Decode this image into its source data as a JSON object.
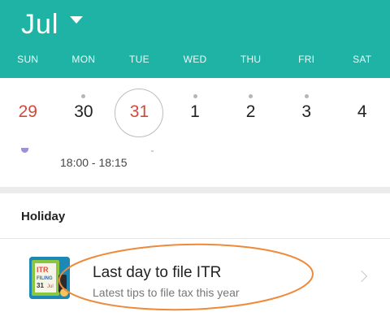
{
  "header": {
    "month": "Jul",
    "bg_color": "#1fb3a5"
  },
  "weekdays": [
    "SUN",
    "MON",
    "TUE",
    "WED",
    "THU",
    "FRI",
    "SAT"
  ],
  "days": [
    {
      "num": "29",
      "dot": false
    },
    {
      "num": "30",
      "dot": true
    },
    {
      "num": "31",
      "dot": false
    },
    {
      "num": "1",
      "dot": true
    },
    {
      "num": "2",
      "dot": true
    },
    {
      "num": "3",
      "dot": true
    },
    {
      "num": "4",
      "dot": false
    }
  ],
  "event": {
    "time": "18:00 - 18:15"
  },
  "holiday": {
    "section_title": "Holiday",
    "item_title": "Last day to file ITR",
    "item_subtitle": "Latest tips to file tax this year",
    "thumbnail_text": [
      "ITR",
      "FILING",
      "31",
      "Jul"
    ]
  },
  "colors": {
    "accent": "#1fb3a5",
    "today_red": "#d04a3b",
    "annotation_orange": "#ee8a3a"
  }
}
